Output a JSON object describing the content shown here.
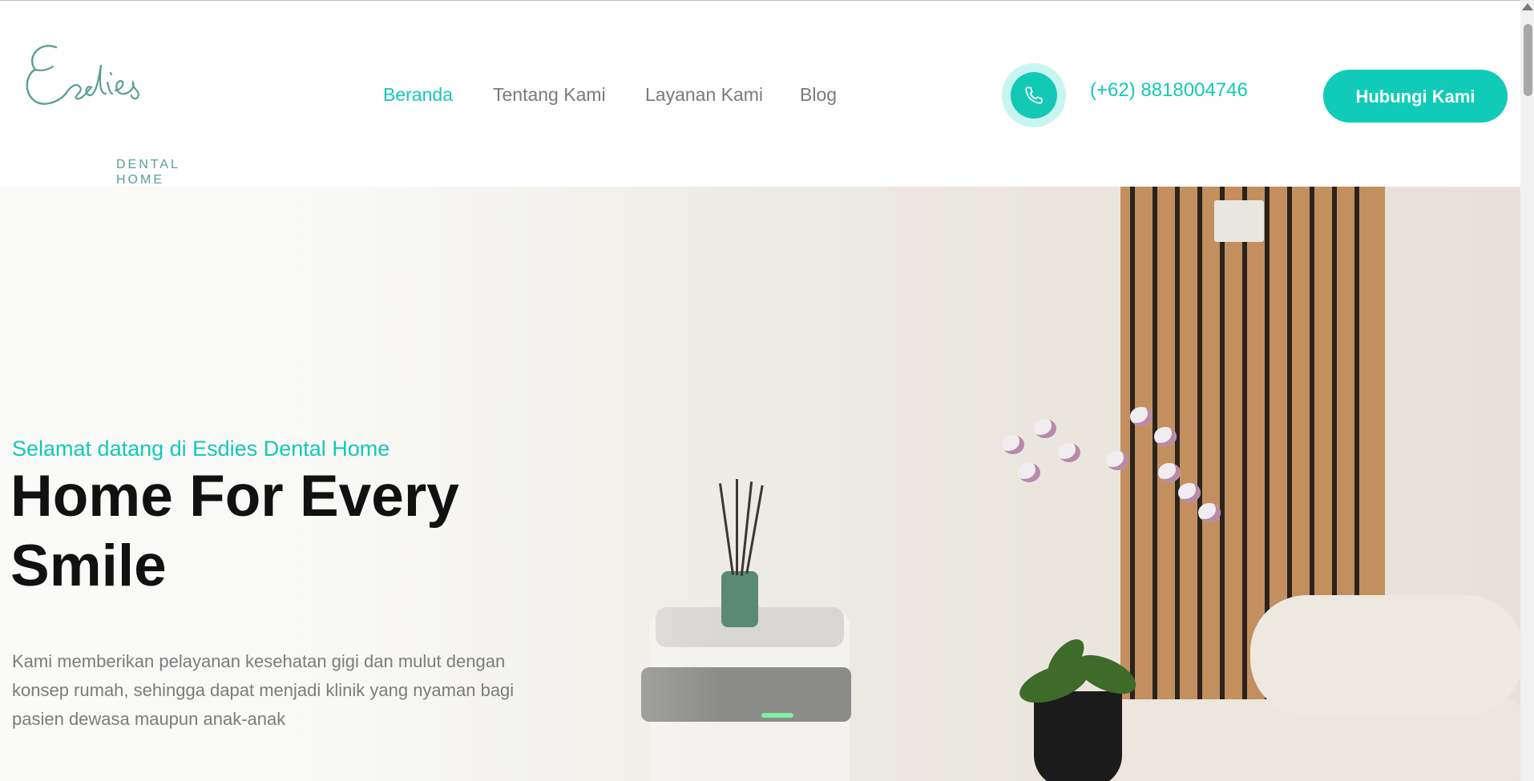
{
  "header": {
    "logo": {
      "name": "Esdies",
      "sub_line1": "DENTAL",
      "sub_line2": "HOME"
    },
    "nav": [
      {
        "label": "Beranda",
        "active": true
      },
      {
        "label": "Tentang Kami",
        "active": false
      },
      {
        "label": "Layanan Kami",
        "active": false
      },
      {
        "label": "Blog",
        "active": false
      }
    ],
    "phone": {
      "icon": "phone-icon",
      "number": "(+62) 8818004746"
    },
    "cta_label": "Hubungi Kami"
  },
  "hero": {
    "welcome": "Selamat datang di Esdies Dental Home",
    "title": "Home For Every Smile",
    "description": "Kami memberikan pelayanan kesehatan gigi dan mulut dengan konsep rumah, sehingga dapat menjadi klinik yang nyaman bagi pasien dewasa maupun anak-anak"
  },
  "colors": {
    "accent": "#12c9b6",
    "button": "#0fcbb8",
    "logo": "#5a9e94",
    "text_dark": "#111111",
    "text_muted": "#7c7c7c"
  }
}
